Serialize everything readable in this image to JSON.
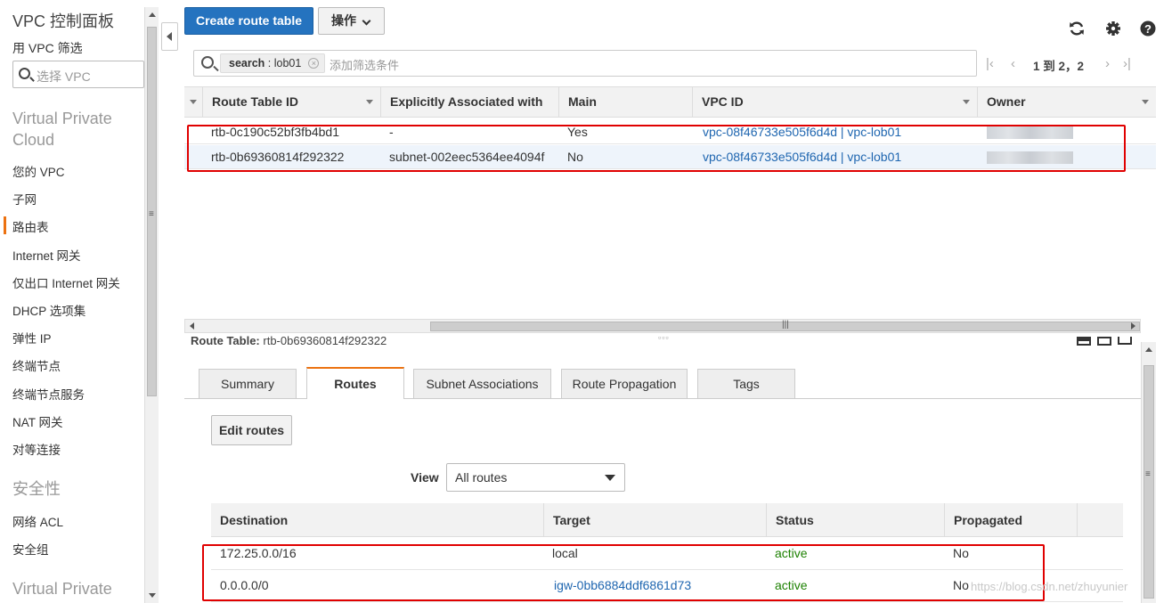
{
  "sidebar": {
    "title": "VPC 控制面板",
    "filter_label": "用 VPC 筛选",
    "filter_placeholder": "选择 VPC",
    "section_vpc": "Virtual Private Cloud",
    "items": [
      "您的 VPC",
      "子网",
      "路由表",
      "Internet 网关",
      "仅出口 Internet 网关",
      "DHCP 选项集",
      "弹性 IP",
      "终端节点",
      "终端节点服务",
      "NAT 网关",
      "对等连接"
    ],
    "active_item": "路由表",
    "section_security": "安全性",
    "security_items": [
      "网络 ACL",
      "安全组"
    ],
    "section_vpn": "Virtual Private"
  },
  "toolbar": {
    "create_label": "Create route table",
    "actions_label": "操作",
    "refresh_icon": "refresh-icon",
    "settings_icon": "gear-icon",
    "help_icon": "help-icon"
  },
  "filter": {
    "chip_key": "search",
    "chip_value": " : lob01",
    "placeholder": "添加筛选条件"
  },
  "pager": {
    "text": "1 到 2，2"
  },
  "table": {
    "columns": [
      "Route Table ID",
      "Explicitly Associated with",
      "Main",
      "VPC ID",
      "Owner"
    ],
    "rows": [
      {
        "id": "rtb-0c190c52bf3fb4bd1",
        "assoc": "-",
        "main": "Yes",
        "vpc": "vpc-08f46733e505f6d4d | vpc-lob01"
      },
      {
        "id": "rtb-0b69360814f292322",
        "assoc": "subnet-002eec5364ee4094f",
        "main": "No",
        "vpc": "vpc-08f46733e505f6d4d | vpc-lob01"
      }
    ],
    "selected_row": 1
  },
  "detail": {
    "title_label": "Route Table:",
    "title_value": " rtb-0b69360814f292322",
    "tabs": [
      "Summary",
      "Routes",
      "Subnet Associations",
      "Route Propagation",
      "Tags"
    ],
    "active_tab": "Routes",
    "edit_label": "Edit routes",
    "view_label": "View",
    "view_value": "All routes",
    "route_columns": [
      "Destination",
      "Target",
      "Status",
      "Propagated"
    ],
    "routes": [
      {
        "destination": "172.25.0.0/16",
        "target": "local",
        "status": "active",
        "propagated": "No"
      },
      {
        "destination": "0.0.0.0/0",
        "target": "igw-0bb6884ddf6861d73",
        "status": "active",
        "propagated": "No"
      }
    ]
  },
  "colors": {
    "primary": "#2573bf",
    "accent": "#ec7211",
    "link": "#1f66b0",
    "active": "#1d8102",
    "highlight": "#e00000"
  },
  "watermark": "https://blog.csdn.net/zhuyunier"
}
